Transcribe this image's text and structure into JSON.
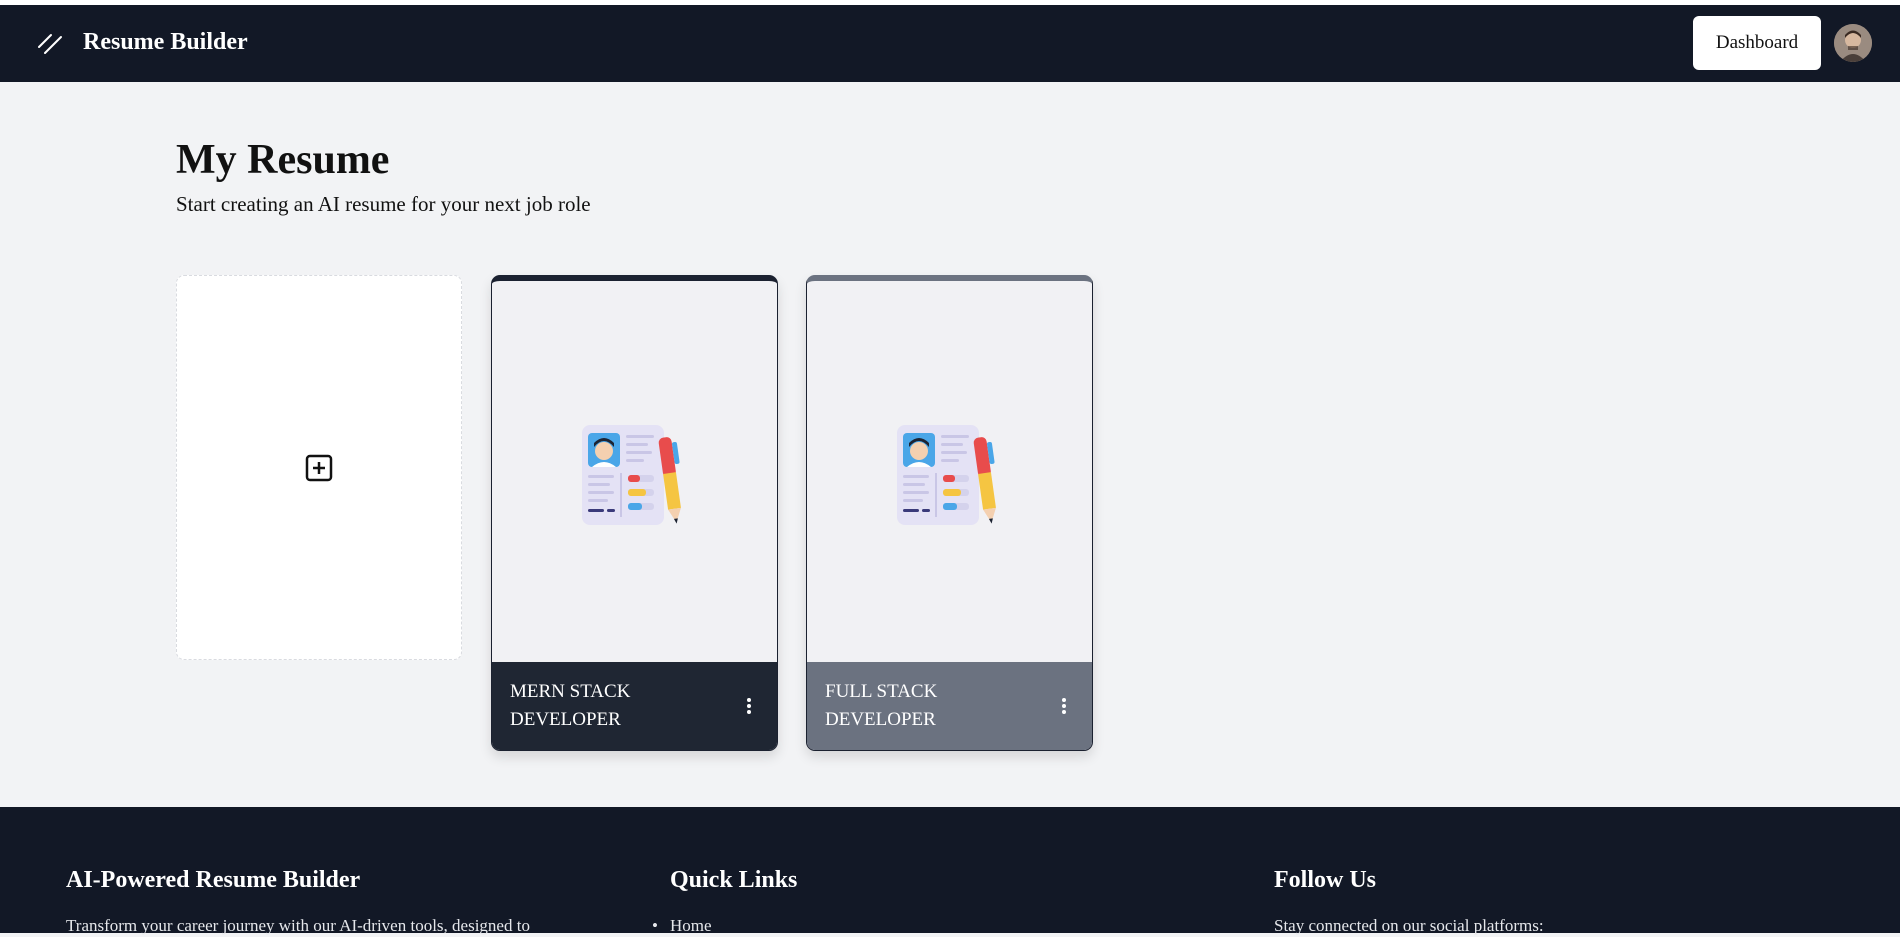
{
  "header": {
    "brand": "Resume Builder",
    "dashboard_label": "Dashboard",
    "logo_icon": "slash-lines-icon",
    "avatar_icon": "user-avatar"
  },
  "main": {
    "title": "My Resume",
    "subtitle": "Start creating an AI resume for your next job role",
    "add_icon": "plus-square-icon",
    "resumes": [
      {
        "title": "MERN STACK DEVELOPER",
        "footer_color": "#1f2633"
      },
      {
        "title": "FULL STACK DEVELOPER",
        "footer_color": "#6b7280"
      }
    ]
  },
  "footer": {
    "col1_title": "AI-Powered Resume Builder",
    "col1_text": "Transform your career journey with our AI-driven tools, designed to",
    "col2_title": "Quick Links",
    "col2_links": [
      "Home"
    ],
    "col3_title": "Follow Us",
    "col3_text": "Stay connected on our social platforms:"
  },
  "colors": {
    "header_bg": "#121826",
    "page_bg": "#f2f3f5",
    "footer_bg": "#121826"
  }
}
